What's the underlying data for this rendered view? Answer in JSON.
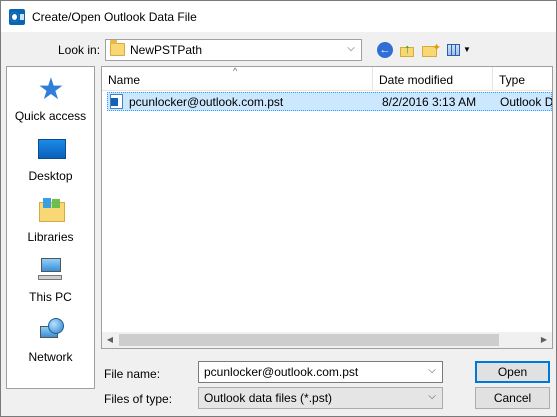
{
  "window": {
    "title": "Create/Open Outlook Data File",
    "app_icon": "outlook-icon"
  },
  "toolbar": {
    "lookin_label": "Look in:",
    "lookin_value": "NewPSTPath",
    "lookin_icon": "folder-icon",
    "buttons": {
      "back": "back-icon",
      "up": "up-folder-icon",
      "new_folder": "new-folder-icon",
      "views": "views-menu-icon"
    }
  },
  "places": [
    {
      "label": "Quick access",
      "icon": "star-icon"
    },
    {
      "label": "Desktop",
      "icon": "desktop-icon"
    },
    {
      "label": "Libraries",
      "icon": "libraries-icon"
    },
    {
      "label": "This PC",
      "icon": "computer-icon"
    },
    {
      "label": "Network",
      "icon": "network-icon"
    }
  ],
  "file_list": {
    "columns": [
      "Name",
      "Date modified",
      "Type"
    ],
    "sort_column": "Name",
    "rows": [
      {
        "name": "pcunlocker@outlook.com.pst",
        "date": "8/2/2016 3:13 AM",
        "type": "Outlook D",
        "icon": "pst-file-icon",
        "selected": true
      }
    ]
  },
  "footer": {
    "file_name_label": "File name:",
    "file_name_value": "pcunlocker@outlook.com.pst",
    "file_type_label": "Files of type:",
    "file_type_value": "Outlook data files (*.pst)",
    "open_label": "Open",
    "cancel_label": "Cancel"
  },
  "colors": {
    "selection_bg": "#cce8ff",
    "selection_border": "#3399ff",
    "default_button_border": "#0078d7",
    "dialog_bg": "#f0f0f0"
  }
}
